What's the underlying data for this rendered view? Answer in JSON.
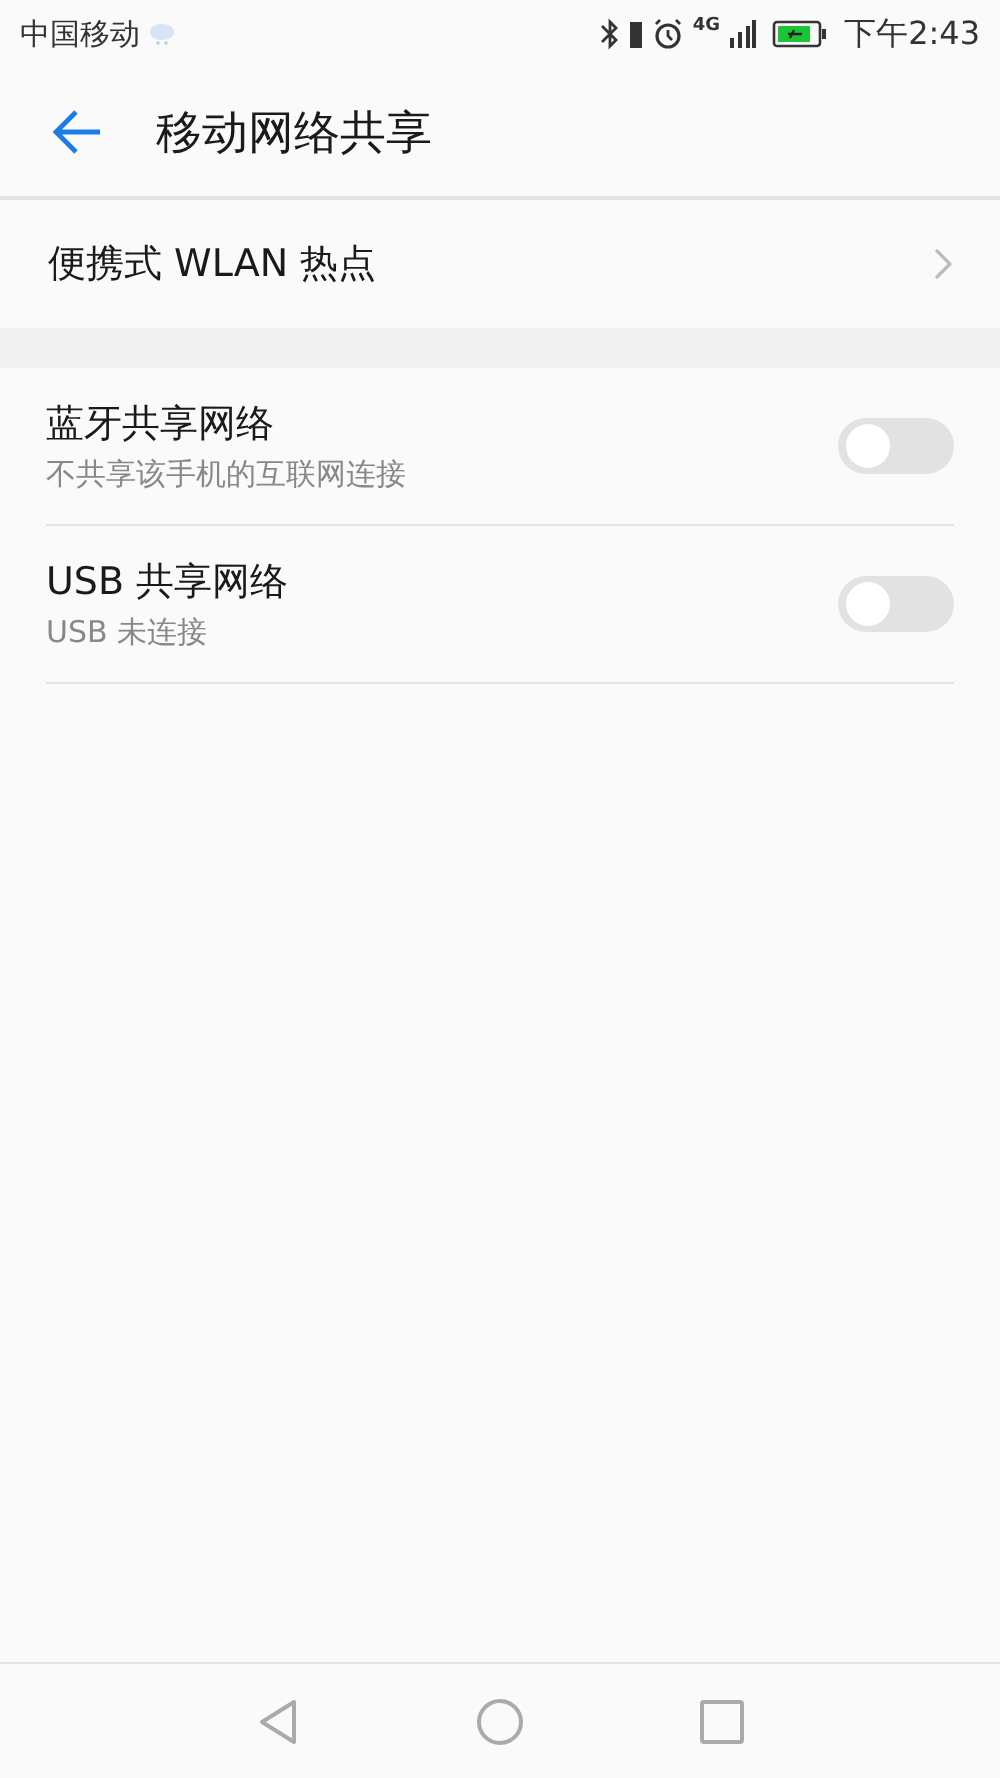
{
  "status_bar": {
    "carrier": "中国移动",
    "network": "4G",
    "time": "下午2:43"
  },
  "header": {
    "title": "移动网络共享"
  },
  "items": [
    {
      "kind": "link",
      "title": "便携式 WLAN 热点"
    }
  ],
  "toggles": [
    {
      "title": "蓝牙共享网络",
      "subtitle": "不共享该手机的互联网连接",
      "on": false
    },
    {
      "title": "USB 共享网络",
      "subtitle": "USB 未连接",
      "on": false
    }
  ]
}
